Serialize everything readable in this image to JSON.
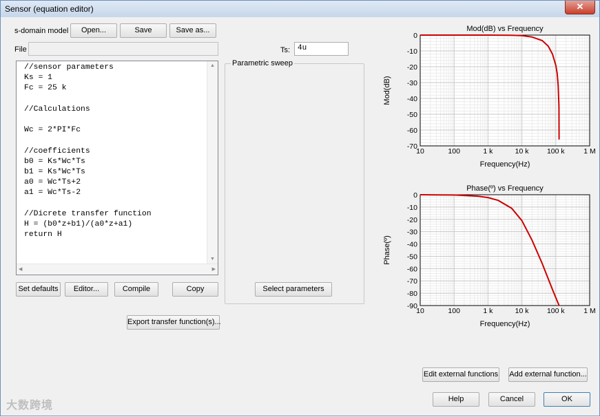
{
  "window": {
    "title": "Sensor (equation editor)",
    "close_label": "✕"
  },
  "toolbar": {
    "model_label": "s-domain model",
    "open_label": "Open...",
    "save_label": "Save",
    "save_as_label": "Save as..."
  },
  "file": {
    "label": "File",
    "value": ""
  },
  "ts": {
    "label": "Ts:",
    "value": "4u"
  },
  "editor": {
    "lines": [
      "//sensor parameters",
      "Ks = 1",
      "Fc = 25 k",
      "",
      "//Calculations",
      "",
      "Wc = 2*PI*Fc",
      "",
      "//coefficients",
      "b0 = Ks*Wc*Ts",
      "b1 = Ks*Wc*Ts",
      "a0 = Wc*Ts+2",
      "a1 = Wc*Ts-2",
      "",
      "//Dicrete transfer function",
      "H = (b0*z+b1)/(a0*z+a1)",
      "return H"
    ]
  },
  "editor_buttons": {
    "set_defaults": "Set defaults",
    "editor": "Editor...",
    "compile": "Compile",
    "copy": "Copy"
  },
  "sweep": {
    "title": "Parametric sweep",
    "select_label": "Select parameters"
  },
  "export_label": "Export transfer function(s)...",
  "footer": {
    "edit_external": "Edit external functions",
    "add_external": "Add external function...",
    "help": "Help",
    "cancel": "Cancel",
    "ok": "OK"
  },
  "watermark": "大数跨境",
  "colors": {
    "curve": "#cc0000",
    "grid_major": "#c8c8c8",
    "grid_minor": "#ececec"
  },
  "chart_data": [
    {
      "type": "line",
      "title": "Mod(dB) vs Frequency",
      "xlabel": "Frequency(Hz)",
      "ylabel": "Mod(dB)",
      "xscale": "log",
      "xlim": [
        10,
        1000000
      ],
      "ylim": [
        -70,
        0
      ],
      "xticks": [
        "10",
        "100",
        "1 k",
        "10 k",
        "100 k",
        "1 M"
      ],
      "yticks": [
        "0",
        "-10",
        "-20",
        "-30",
        "-40",
        "-50",
        "-60",
        "-70"
      ],
      "grid": true,
      "series": [
        {
          "x": [
            10,
            1000,
            5000,
            10000,
            20000,
            40000,
            60000,
            80000,
            100000,
            110000,
            118000,
            124000,
            125000
          ],
          "y": [
            0,
            0,
            -0.1,
            -0.3,
            -1.2,
            -3.5,
            -7,
            -12,
            -19,
            -24,
            -32,
            -45,
            -66
          ]
        }
      ]
    },
    {
      "type": "line",
      "title": "Phase(º) vs Frequency",
      "xlabel": "Frequency(Hz)",
      "ylabel": "Phase(º)",
      "xscale": "log",
      "xlim": [
        10,
        1000000
      ],
      "ylim": [
        -90,
        0
      ],
      "xticks": [
        "10",
        "100",
        "1 k",
        "10 k",
        "100 k",
        "1 M"
      ],
      "yticks": [
        "0",
        "-10",
        "-20",
        "-30",
        "-40",
        "-50",
        "-60",
        "-70",
        "-80",
        "-90"
      ],
      "grid": true,
      "series": [
        {
          "x": [
            10,
            100,
            500,
            1000,
            2000,
            5000,
            10000,
            20000,
            40000,
            80000,
            125000
          ],
          "y": [
            0,
            -0.2,
            -1.2,
            -2.3,
            -4.6,
            -11,
            -21,
            -37,
            -56,
            -77,
            -90
          ]
        }
      ]
    }
  ]
}
